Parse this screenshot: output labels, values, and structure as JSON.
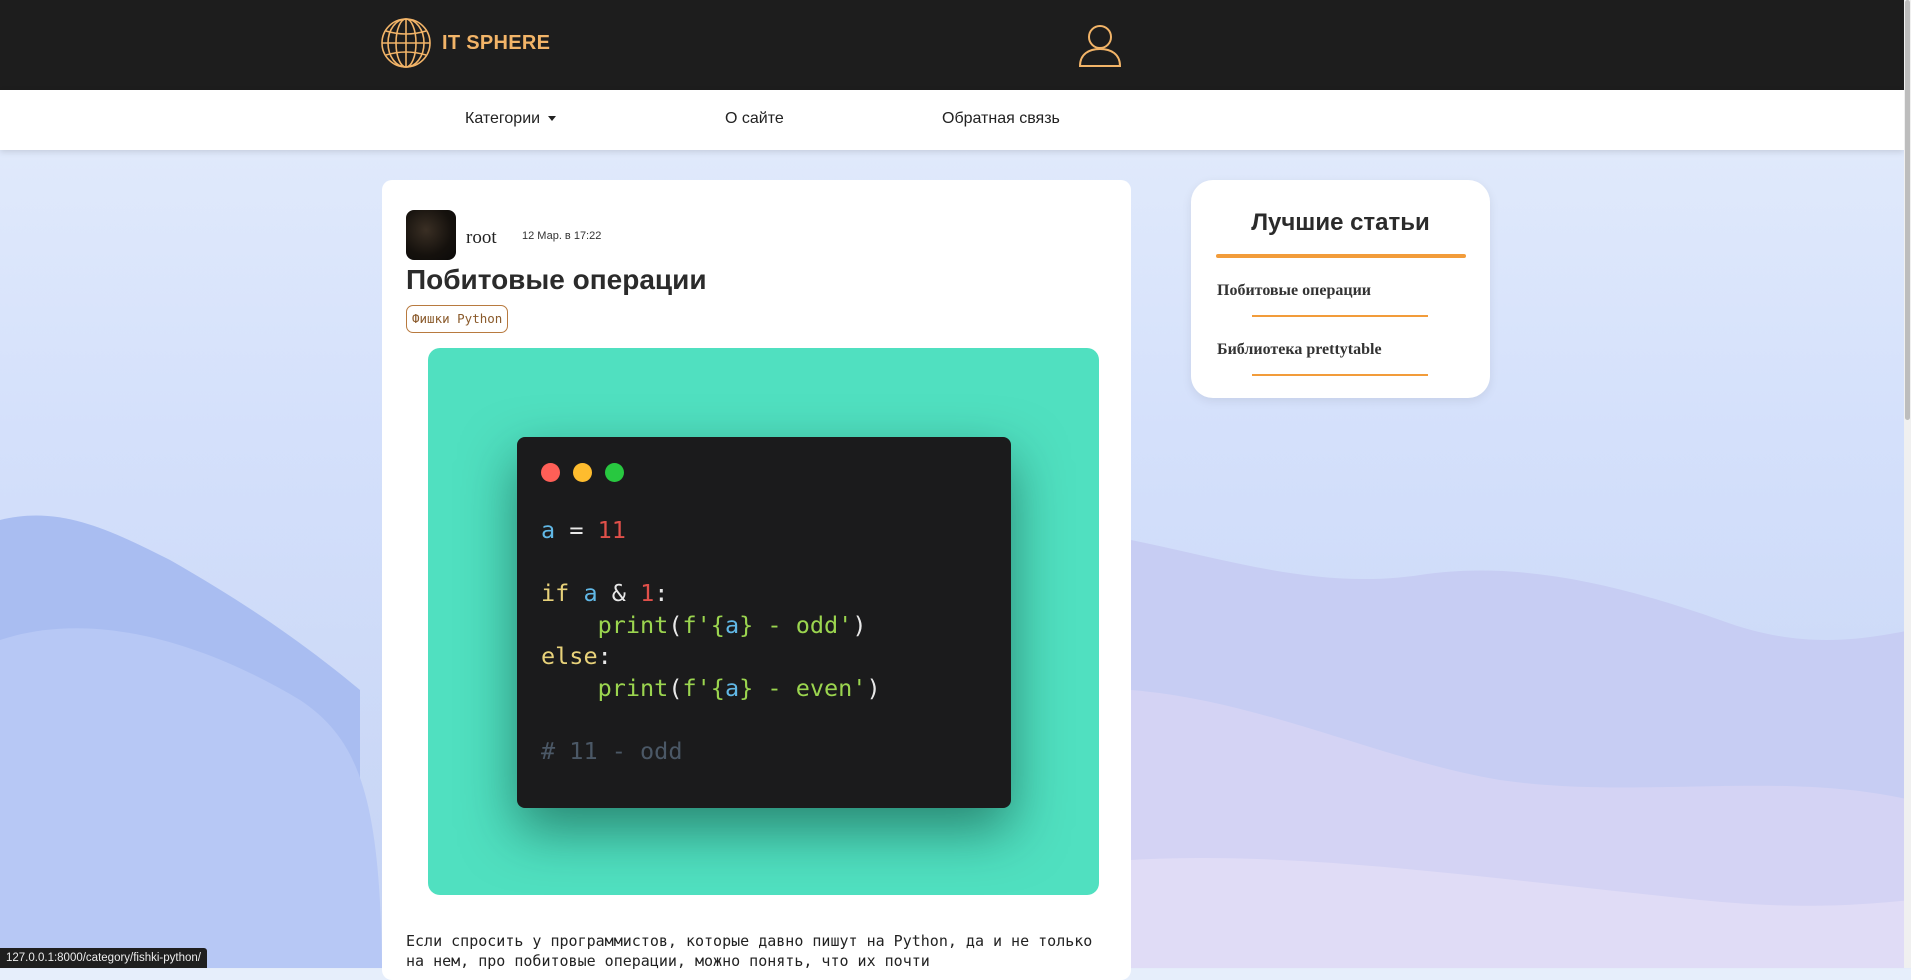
{
  "header": {
    "logo_text": "IT SPHERE",
    "logo_icon": "globe-icon",
    "user_icon": "user-icon"
  },
  "nav": {
    "categories": "Категории",
    "about": "О сайте",
    "feedback": "Обратная связь"
  },
  "article": {
    "author": "root",
    "date": "12 Мар. в 17:22",
    "title": "Побитовые операции",
    "tag": "Фишки Python",
    "code_lines": [
      "a = 11",
      "",
      "if a & 1:",
      "    print(f'{a} - odd')",
      "else:",
      "    print(f'{a} - even')",
      "",
      "# 11 - odd"
    ],
    "body_text": "Если спросить у программистов, которые давно пишут на Python, да и не только на нем, про побитовые операции, можно понять, что их почти"
  },
  "sidebar": {
    "title": "Лучшие статьи",
    "links": [
      {
        "label": "Побитовые операции"
      },
      {
        "label": "Библиотека prettytable"
      }
    ]
  },
  "status_bar": {
    "url": "127.0.0.1:8000/category/fishki-python/"
  },
  "colors": {
    "header_bg": "#1d1d1d",
    "accent": "#f29c3a",
    "logo": "#f2b468",
    "code_panel": "#50e0c0",
    "code_bg": "#1b1b1c"
  }
}
